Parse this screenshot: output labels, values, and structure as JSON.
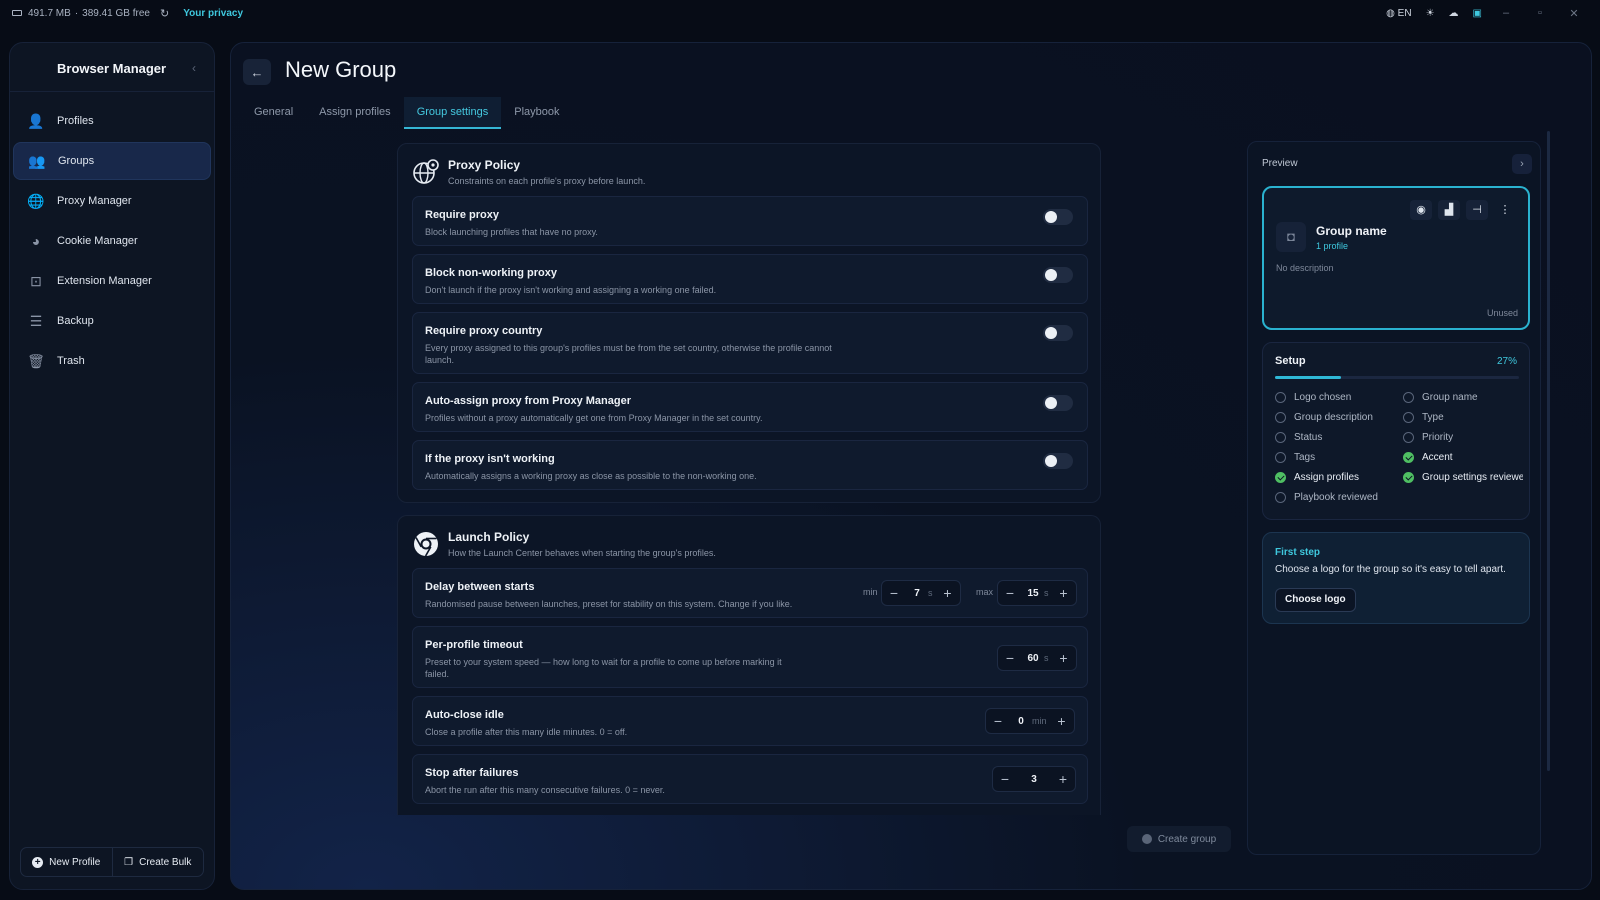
{
  "topbar": {
    "memory": "491.7 MB",
    "separator": "·",
    "disk": "389.41 GB free",
    "privacy": "Your privacy",
    "language": "EN"
  },
  "sidebar": {
    "title": "Browser Manager",
    "items": [
      {
        "label": "Profiles",
        "icon": "user-icon"
      },
      {
        "label": "Groups",
        "icon": "users-icon"
      },
      {
        "label": "Proxy Manager",
        "icon": "globe-icon"
      },
      {
        "label": "Cookie Manager",
        "icon": "cookie-icon"
      },
      {
        "label": "Extension Manager",
        "icon": "puzzle-icon"
      },
      {
        "label": "Backup",
        "icon": "database-icon"
      },
      {
        "label": "Trash",
        "icon": "trash-icon"
      }
    ],
    "new_profile": "New Profile",
    "create_bulk": "Create Bulk"
  },
  "page": {
    "title": "New Group",
    "tabs": [
      "General",
      "Assign profiles",
      "Group settings",
      "Playbook"
    ],
    "active_tab": "Group settings"
  },
  "proxy_policy": {
    "title": "Proxy Policy",
    "subtitle": "Constraints on each profile's proxy before launch.",
    "rows": [
      {
        "title": "Require proxy",
        "desc": "Block launching profiles that have no proxy.",
        "enabled": false
      },
      {
        "title": "Block non-working proxy",
        "desc": "Don't launch if the proxy isn't working and assigning a working one failed.",
        "enabled": false
      },
      {
        "title": "Require proxy country",
        "desc": "Every proxy assigned to this group's profiles must be from the set country, otherwise the profile cannot launch.",
        "enabled": false
      },
      {
        "title": "Auto-assign proxy from Proxy Manager",
        "desc": "Profiles without a proxy automatically get one from Proxy Manager in the set country.",
        "enabled": false
      },
      {
        "title": "If the proxy isn't working",
        "desc": "Automatically assigns a working proxy as close as possible to the non-working one.",
        "enabled": false
      }
    ]
  },
  "launch_policy": {
    "title": "Launch Policy",
    "subtitle": "How the Launch Center behaves when starting the group's profiles.",
    "delay": {
      "title": "Delay between starts",
      "desc": "Randomised pause between launches, preset for stability on this system. Change if you like.",
      "min_label": "min",
      "min_value": "7",
      "max_label": "max",
      "max_value": "15",
      "unit": "s"
    },
    "timeout": {
      "title": "Per-profile timeout",
      "desc": "Preset to your system speed — how long to wait for a profile to come up before marking it failed.",
      "value": "60",
      "unit": "s"
    },
    "idle": {
      "title": "Auto-close idle",
      "desc": "Close a profile after this many idle minutes. 0 = off.",
      "value": "0",
      "unit": "min"
    },
    "failures": {
      "title": "Stop after failures",
      "desc": "Abort the run after this many consecutive failures. 0 = never.",
      "value": "3"
    }
  },
  "preview": {
    "title": "Preview",
    "group_name": "Group name",
    "profiles": "1 profile",
    "description": "No description",
    "status": "Unused"
  },
  "setup": {
    "title": "Setup",
    "percent": "27%",
    "progress": 0.27,
    "items": [
      {
        "label": "Logo chosen",
        "done": false
      },
      {
        "label": "Group name",
        "done": false
      },
      {
        "label": "Group description",
        "done": false
      },
      {
        "label": "Type",
        "done": false
      },
      {
        "label": "Status",
        "done": false
      },
      {
        "label": "Priority",
        "done": false
      },
      {
        "label": "Tags",
        "done": false
      },
      {
        "label": "Accent",
        "done": true
      },
      {
        "label": "Assign profiles",
        "done": true
      },
      {
        "label": "Group settings reviewed",
        "done": true
      },
      {
        "label": "Playbook reviewed",
        "done": false
      }
    ]
  },
  "first_step": {
    "title": "First step",
    "desc": "Choose a logo for the group so it's easy to tell apart.",
    "button": "Choose logo"
  },
  "footer": {
    "create_group": "Create group"
  },
  "colors": {
    "accent": "#3fc8de",
    "success": "#4fbf63",
    "background": "#070c16"
  }
}
